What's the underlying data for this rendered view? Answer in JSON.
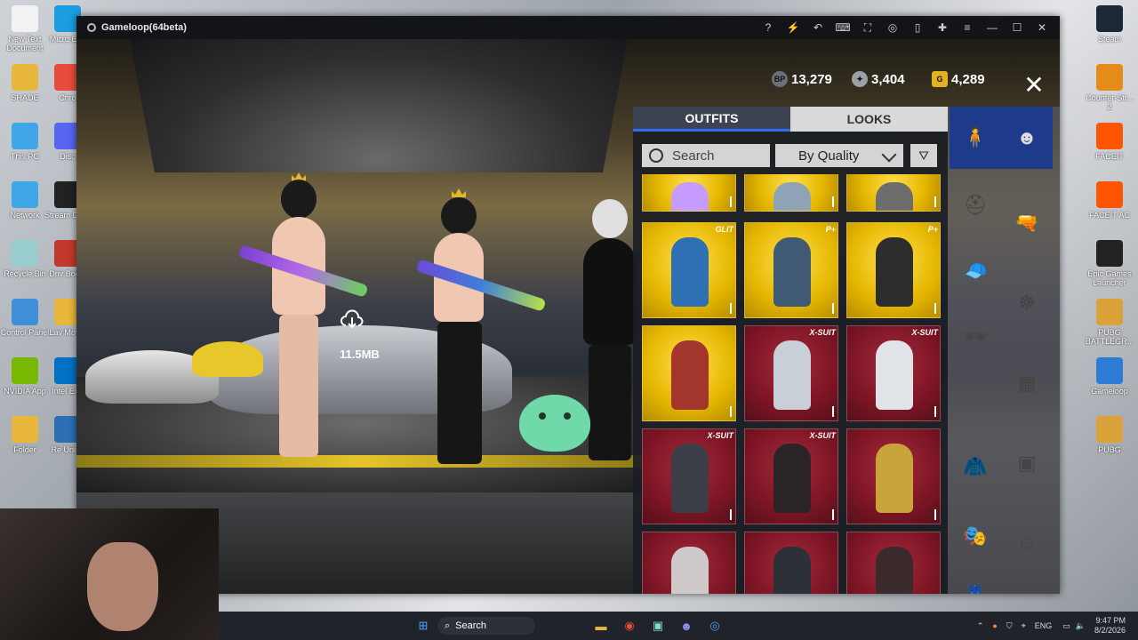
{
  "desktop_left": [
    {
      "label": "New Text Document",
      "name": "desktop-icon-text-document",
      "color": "#f2f2f2"
    },
    {
      "label": "SHADE",
      "name": "desktop-icon-shade",
      "color": "#e8b73c"
    },
    {
      "label": "This PC",
      "name": "desktop-icon-this-pc",
      "color": "#3fa7e8"
    },
    {
      "label": "Network",
      "name": "desktop-icon-network",
      "color": "#3fa7e8"
    },
    {
      "label": "Recycle Bin",
      "name": "desktop-icon-recycle-bin",
      "color": "#9cc"
    },
    {
      "label": "Control Panel",
      "name": "desktop-icon-control-panel",
      "color": "#3f8fd8"
    },
    {
      "label": "NVIDIA App",
      "name": "desktop-icon-nvidia",
      "color": "#76b900"
    },
    {
      "label": "Folder",
      "name": "desktop-icon-folder",
      "color": "#e8b73c"
    }
  ],
  "desktop_left2": [
    {
      "label": "Micro Edg",
      "name": "desktop-icon-edge",
      "color": "#1b9de2"
    },
    {
      "label": "Chro",
      "name": "desktop-icon-chrome",
      "color": "#e84b3c"
    },
    {
      "label": "Disc",
      "name": "desktop-icon-discord",
      "color": "#5865f2"
    },
    {
      "label": "Stream Desk",
      "name": "desktop-icon-stream-deck",
      "color": "#222"
    },
    {
      "label": "Driv Boost",
      "name": "desktop-icon-driver-booster",
      "color": "#c0392b"
    },
    {
      "label": "Lav Movin",
      "name": "desktop-icon-lav",
      "color": "#e8b73c"
    },
    {
      "label": "Intel Extr",
      "name": "desktop-icon-intel",
      "color": "#0071c5"
    },
    {
      "label": "Re Unins",
      "name": "desktop-icon-revo",
      "color": "#2c6fb5"
    }
  ],
  "desktop_right": [
    {
      "label": "Steam",
      "name": "desktop-icon-steam",
      "color": "#1b2838"
    },
    {
      "label": "Counter-Str... 2",
      "name": "desktop-icon-counter-strike",
      "color": "#e58b1a"
    },
    {
      "label": "FACEIT",
      "name": "desktop-icon-faceit",
      "color": "#ff5500"
    },
    {
      "label": "FACEIT AC",
      "name": "desktop-icon-faceit-ac",
      "color": "#ff5500"
    },
    {
      "label": "Epic Games Launcher",
      "name": "desktop-icon-epic",
      "color": "#222"
    },
    {
      "label": "PUBG BATTLEGR...",
      "name": "desktop-icon-pubg-battlegrounds",
      "color": "#d9a33a"
    },
    {
      "label": "Gameloop",
      "name": "desktop-icon-gameloop",
      "color": "#2d7bd6"
    },
    {
      "label": "PUBG",
      "name": "desktop-icon-pubg",
      "color": "#d9a33a"
    }
  ],
  "window": {
    "title": "Gameloop(64beta)"
  },
  "currency": {
    "bp": "13,279",
    "silver": "3,404",
    "uc": "4,289",
    "bp_symbol": "BP",
    "uc_symbol": "G"
  },
  "download": {
    "size": "11.5MB"
  },
  "panel": {
    "tab_outfits": "OUTFITS",
    "tab_looks": "LOOKS",
    "search_placeholder": "Search",
    "sort_label": "By Quality"
  },
  "tiles": [
    {
      "rarity": "gold",
      "badge": "",
      "fig": "#c69bff"
    },
    {
      "rarity": "gold",
      "badge": "",
      "fig": "#8fa3b7"
    },
    {
      "rarity": "gold",
      "badge": "",
      "fig": "#6d6d6d"
    },
    {
      "rarity": "gold",
      "badge": "GLIT",
      "fig": "#2f6fb4"
    },
    {
      "rarity": "gold",
      "badge": "P+",
      "fig": "#3f5a72"
    },
    {
      "rarity": "gold",
      "badge": "P+",
      "fig": "#2d2d2d"
    },
    {
      "rarity": "gold",
      "badge": "",
      "fig": "#a3362c"
    },
    {
      "rarity": "red",
      "badge": "X-SUIT",
      "fig": "#c9cfd6"
    },
    {
      "rarity": "red",
      "badge": "X-SUIT",
      "fig": "#e0e3e8"
    },
    {
      "rarity": "red",
      "badge": "X-SUIT",
      "fig": "#3c3f48"
    },
    {
      "rarity": "red",
      "badge": "X-SUIT",
      "fig": "#2a2328"
    },
    {
      "rarity": "red",
      "badge": "",
      "fig": "#c9a43a"
    },
    {
      "rarity": "red",
      "badge": "",
      "fig": "#cfc9c9"
    },
    {
      "rarity": "red",
      "badge": "",
      "fig": "#2d3036"
    },
    {
      "rarity": "red",
      "badge": "",
      "fig": "#3a2a2c"
    }
  ],
  "taskbar": {
    "search": "Search",
    "lang": "ENG",
    "time": "9:47 PM",
    "date": "8/2/2026"
  }
}
